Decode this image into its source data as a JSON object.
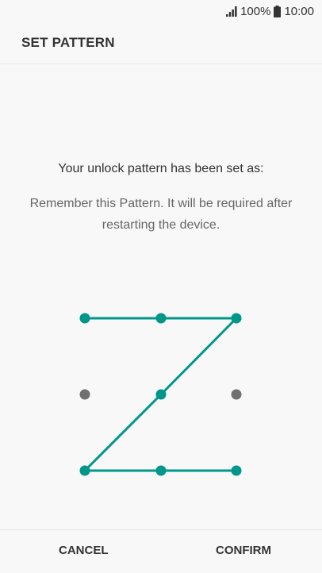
{
  "status_bar": {
    "battery": "100%",
    "time": "10:00",
    "icons": [
      "signal-icon",
      "battery-icon"
    ]
  },
  "header": {
    "title": "SET PATTERN"
  },
  "content": {
    "message": "Your unlock pattern has been set as:",
    "sub_message": "Remember this Pattern. It will be required after restarting the device."
  },
  "pattern": {
    "grid": "3x3",
    "sequence": [
      1,
      2,
      3,
      5,
      7,
      8,
      9
    ],
    "active_color": "#00968a",
    "inactive_color": "#707070"
  },
  "actions": {
    "cancel_label": "CANCEL",
    "confirm_label": "CONFIRM"
  }
}
